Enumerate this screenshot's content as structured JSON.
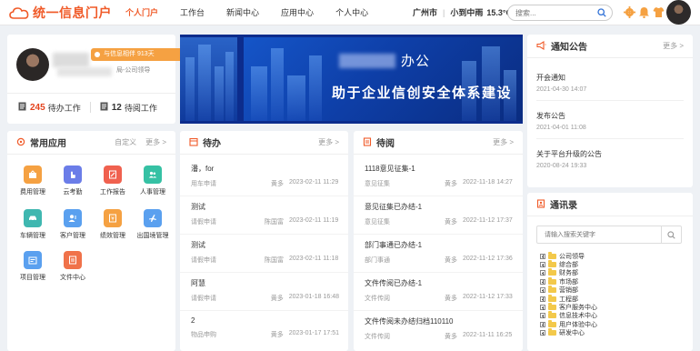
{
  "header": {
    "logo_text": "统一信息门户",
    "nav": [
      "个人门户",
      "工作台",
      "新闻中心",
      "应用中心",
      "个人中心"
    ],
    "active_nav": 0,
    "city": "广州市",
    "weather": "小到中雨",
    "temperature": "15.3°C",
    "search_placeholder": "搜索..."
  },
  "profile": {
    "days_badge": "与信息相伴 913天",
    "role": "局-公司领导",
    "pending_label": "待办工作",
    "pending_count": "245",
    "read_label": "待阅工作",
    "read_count": "12"
  },
  "banner": {
    "line1": "办公",
    "line2": "助于企业信创安全体系建设"
  },
  "notice": {
    "title": "通知公告",
    "more": "更多 >",
    "items": [
      {
        "title": "开会通知",
        "date": "2021-04-30 14:07"
      },
      {
        "title": "发布公告",
        "date": "2021-04-01 11:08"
      },
      {
        "title": "关于平台升级的公告",
        "date": "2020-08-24 19:33"
      }
    ]
  },
  "apps": {
    "title": "常用应用",
    "custom": "自定义",
    "more": "更多 >",
    "items": [
      {
        "label": "费用管理",
        "icon": "expense-icon",
        "color": "#f5a142"
      },
      {
        "label": "云考勤",
        "icon": "attendance-icon",
        "color": "#6b7de8"
      },
      {
        "label": "工作报告",
        "icon": "report-icon",
        "color": "#f0614f"
      },
      {
        "label": "人事管理",
        "icon": "hr-icon",
        "color": "#36c1a4"
      },
      {
        "label": "车辆管理",
        "icon": "car-icon",
        "color": "#3fb7b0"
      },
      {
        "label": "客户管理",
        "icon": "customer-icon",
        "color": "#5aa0ef"
      },
      {
        "label": "绩效管理",
        "icon": "performance-icon",
        "color": "#f5a142"
      },
      {
        "label": "出国境管理",
        "icon": "plane-icon",
        "color": "#5aa0ef"
      },
      {
        "label": "项目管理",
        "icon": "project-icon",
        "color": "#5aa0ef"
      },
      {
        "label": "文件中心",
        "icon": "file-icon",
        "color": "#f0724a"
      }
    ]
  },
  "todo": {
    "title": "待办",
    "more": "更多 >",
    "items": [
      {
        "title": "潘，for",
        "cat": "用车申请",
        "who": "黄多",
        "date": "2023-02-11 11:29"
      },
      {
        "title": "测试",
        "cat": "请假申请",
        "who": "陈国富",
        "date": "2023-02-11 11:19"
      },
      {
        "title": "测试",
        "cat": "请假申请",
        "who": "陈国富",
        "date": "2023-02-11 11:18"
      },
      {
        "title": "阿慧",
        "cat": "请假申请",
        "who": "黄多",
        "date": "2023-01-18 16:48"
      },
      {
        "title": "2",
        "cat": "物品申购",
        "who": "黄多",
        "date": "2023-01-17 17:51"
      }
    ]
  },
  "toread": {
    "title": "待阅",
    "more": "更多 >",
    "items": [
      {
        "title": "1118意见征集-1",
        "cat": "意见征集",
        "who": "黄多",
        "date": "2022-11-18 14:27"
      },
      {
        "title": "意见征集已办结-1",
        "cat": "意见征集",
        "who": "黄多",
        "date": "2022-11-12 17:37"
      },
      {
        "title": "部门事通已办结-1",
        "cat": "部门事通",
        "who": "黄多",
        "date": "2022-11-12 17:36"
      },
      {
        "title": "文件传阅已办结-1",
        "cat": "文件传阅",
        "who": "黄多",
        "date": "2022-11-12 17:33"
      },
      {
        "title": "文件传阅未办结归档110110",
        "cat": "文件传阅",
        "who": "黄多",
        "date": "2022-11-11 16:25"
      }
    ]
  },
  "contacts": {
    "title": "通讯录",
    "search_placeholder": "请输入搜索关键字",
    "tree": [
      "公司领导",
      "综合部",
      "财务部",
      "市场部",
      "营销部",
      "工程部",
      "客户服务中心",
      "信息技术中心",
      "用户体验中心",
      "研发中心"
    ]
  },
  "colors": {
    "accent": "#f05a28",
    "highlight": "#e4441e",
    "badge": "#f5a142"
  }
}
